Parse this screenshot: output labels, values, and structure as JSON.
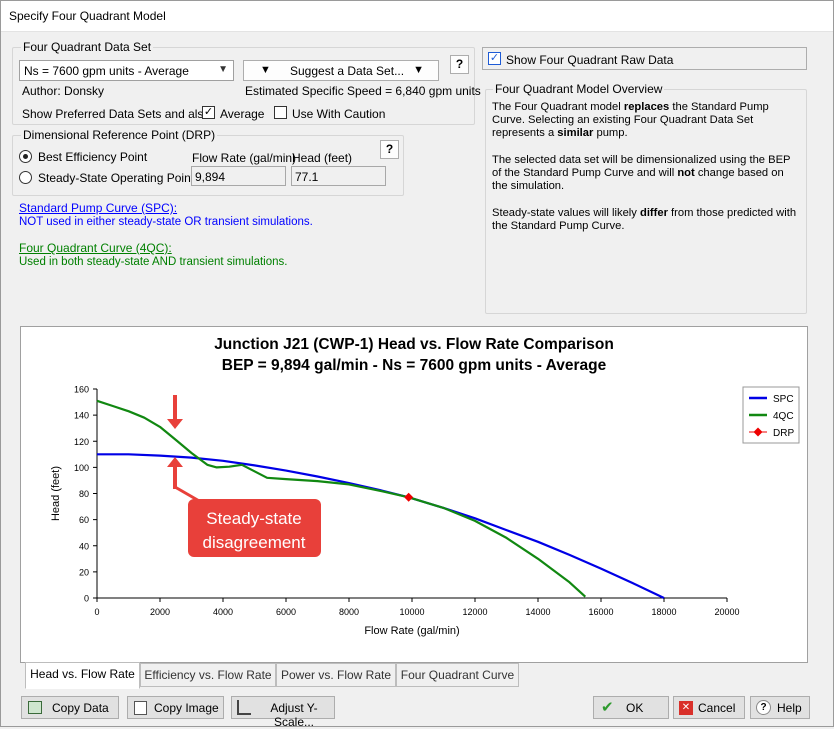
{
  "window": {
    "title": "Specify Four Quadrant Model"
  },
  "dataset": {
    "group_title": "Four Quadrant Data Set",
    "selected": "Ns = 7600 gpm units - Average",
    "suggest_label": "Suggest a Data Set...",
    "help_label": "?",
    "author": "Author: Donsky",
    "specific_speed": "Estimated Specific Speed = 6,840 gpm units",
    "show_preferred_label": "Show Preferred Data Sets and also:",
    "average_label": "Average",
    "average_checked": true,
    "caution_label": "Use With Caution",
    "caution_checked": false
  },
  "drp": {
    "group_title": "Dimensional Reference Point (DRP)",
    "bep_label": "Best Efficiency Point",
    "steady_label": "Steady-State Operating Point",
    "selected": "bep",
    "flow_label": "Flow Rate (gal/min)",
    "head_label": "Head (feet)",
    "flow_value": "9,894",
    "head_value": "77.1",
    "help_label": "?"
  },
  "legend_text": {
    "spc_title": "Standard Pump Curve (SPC):",
    "spc_desc": "NOT used in either steady-state OR transient simulations.",
    "fqc_title": "Four Quadrant Curve (4QC):",
    "fqc_desc": "Used in both steady-state AND transient simulations."
  },
  "raw_data": {
    "label": "Show Four Quadrant Raw Data",
    "checked": true
  },
  "overview": {
    "title": "Four Quadrant Model Overview",
    "p1_a": "The Four Quadrant model ",
    "p1_b": "replaces",
    "p1_c": " the Standard Pump Curve. Selecting an existing Four Quadrant Data Set represents a ",
    "p1_d": "similar",
    "p1_e": " pump.",
    "p2_a": "The selected data set will be dimensionalized using the BEP of the Standard Pump Curve and will ",
    "p2_b": "not",
    "p2_c": " change based on the simulation.",
    "p3_a": "Steady-state values will likely ",
    "p3_b": "differ",
    "p3_c": " from those predicted with the Standard Pump Curve."
  },
  "annotation": {
    "line1": "Steady-state",
    "line2": "disagreement",
    "color": "#e8403a"
  },
  "tabs": [
    {
      "label": "Head vs. Flow Rate",
      "active": true
    },
    {
      "label": "Efficiency vs. Flow Rate",
      "active": false
    },
    {
      "label": "Power vs. Flow Rate",
      "active": false
    },
    {
      "label": "Four Quadrant Curve",
      "active": false
    }
  ],
  "buttons": {
    "copy_data": "Copy Data",
    "copy_image": "Copy Image",
    "adjust_y": "Adjust Y-Scale...",
    "ok": "OK",
    "cancel": "Cancel",
    "help": "Help"
  },
  "icons": {
    "copy_data": "table-copy-icon",
    "copy_image": "image-copy-icon",
    "adjust_y": "chart-scale-icon",
    "ok": "check-icon",
    "cancel": "x-icon",
    "help": "question-icon"
  },
  "chart_data": {
    "type": "line",
    "title": "Junction J21 (CWP-1) Head vs. Flow Rate Comparison",
    "subtitle": "BEP = 9,894 gal/min - Ns = 7600 gpm units - Average",
    "xlabel": "Flow Rate (gal/min)",
    "ylabel": "Head (feet)",
    "xlim": [
      0,
      20000
    ],
    "ylim": [
      0,
      160
    ],
    "xticks": [
      0,
      2000,
      4000,
      6000,
      8000,
      10000,
      12000,
      14000,
      16000,
      18000,
      20000
    ],
    "yticks": [
      0,
      20,
      40,
      60,
      80,
      100,
      120,
      140,
      160
    ],
    "grid": false,
    "legend_position": "top-right",
    "series": [
      {
        "name": "SPC",
        "color": "#0000e6",
        "points": [
          [
            0,
            110
          ],
          [
            1000,
            110
          ],
          [
            2000,
            109
          ],
          [
            3000,
            107.5
          ],
          [
            4000,
            105
          ],
          [
            5000,
            101.5
          ],
          [
            6000,
            97.5
          ],
          [
            7000,
            93
          ],
          [
            8000,
            88
          ],
          [
            9000,
            82.5
          ],
          [
            9894,
            77.1
          ],
          [
            11000,
            69
          ],
          [
            12000,
            61
          ],
          [
            13000,
            52
          ],
          [
            14000,
            43
          ],
          [
            15000,
            33
          ],
          [
            16000,
            22.5
          ],
          [
            17000,
            11.5
          ],
          [
            18000,
            0
          ]
        ]
      },
      {
        "name": "4QC",
        "color": "#118811",
        "points": [
          [
            0,
            151
          ],
          [
            500,
            147
          ],
          [
            1000,
            143
          ],
          [
            1500,
            138
          ],
          [
            2000,
            131
          ],
          [
            2500,
            121
          ],
          [
            3000,
            111
          ],
          [
            3500,
            102
          ],
          [
            3800,
            100
          ],
          [
            4200,
            100.5
          ],
          [
            4600,
            102
          ],
          [
            5000,
            97
          ],
          [
            5400,
            92
          ],
          [
            6000,
            91
          ],
          [
            7000,
            89.5
          ],
          [
            8000,
            87
          ],
          [
            9000,
            82
          ],
          [
            9894,
            77.1
          ],
          [
            11000,
            69
          ],
          [
            12000,
            59
          ],
          [
            13000,
            46
          ],
          [
            14000,
            30
          ],
          [
            15000,
            12
          ],
          [
            15500,
            1
          ]
        ]
      },
      {
        "name": "DRP",
        "color": "#ee0000",
        "marker": "diamond",
        "points": [
          [
            9894,
            77.1
          ]
        ]
      }
    ]
  }
}
